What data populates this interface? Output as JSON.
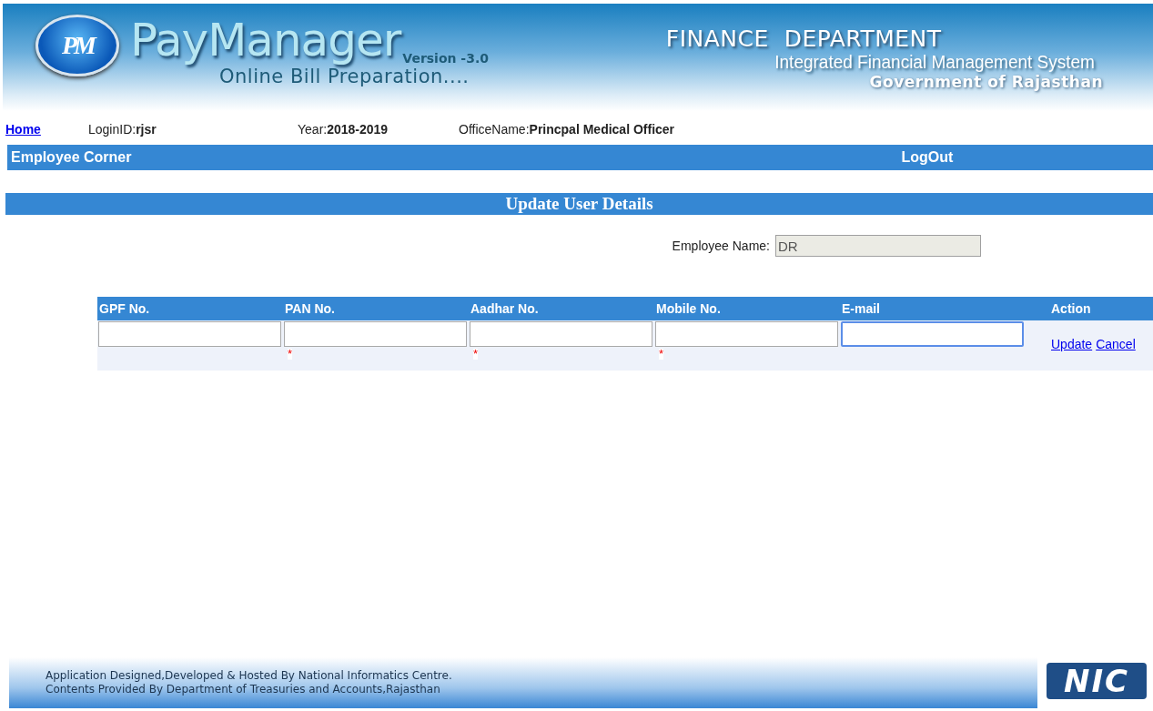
{
  "banner": {
    "logo_text": "PM",
    "app_name": "PayManager",
    "version": "Version -3.0",
    "tagline": "Online Bill Preparation....",
    "department": "FINANCE  DEPARTMENT",
    "system": "Integrated Financial Management System",
    "government": "Government of Rajasthan"
  },
  "info_bar": {
    "home_link": "Home",
    "login_label": "LoginID:",
    "login_value": "rjsr",
    "year_label": "Year:",
    "year_value": "2018-2019",
    "office_label": "OfficeName:",
    "office_value": "Princpal Medical Officer"
  },
  "menu_bar": {
    "left": "Employee Corner",
    "right": "LogOut"
  },
  "section_title": "Update User Details",
  "employee_name": {
    "label": "Employee Name:",
    "value": "DR",
    "disabled": true
  },
  "table": {
    "columns": [
      {
        "heading": "GPF No.",
        "focused": false
      },
      {
        "heading": "PAN No.",
        "mark": "*",
        "focused": false
      },
      {
        "heading": "Aadhar No.",
        "mark": "*",
        "focused": false
      },
      {
        "heading": "Mobile No.",
        "mark": "*",
        "focused": false
      },
      {
        "heading": "E-mail",
        "focused": true
      }
    ],
    "action_heading": "Action",
    "actions": [
      "Update",
      "Cancel"
    ]
  },
  "footer": {
    "lines": [
      "Application Designed,Developed & Hosted By National Informatics Centre.",
      "Contents Provided By Department of  Treasuries and Accounts,Rajasthan"
    ],
    "logo_text": "NIC"
  }
}
